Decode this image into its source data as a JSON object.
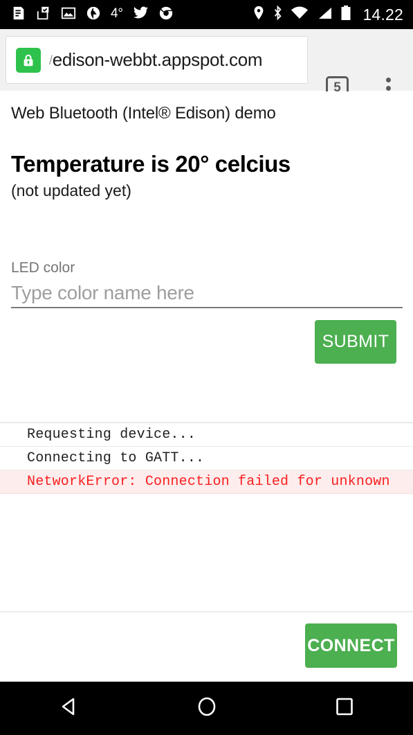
{
  "status_bar": {
    "icons": [
      {
        "name": "news-icon"
      },
      {
        "name": "inbox-check-icon"
      },
      {
        "name": "photo-icon"
      },
      {
        "name": "weather-app-icon"
      },
      {
        "name": "twitter-icon"
      },
      {
        "name": "chrome-icon"
      }
    ],
    "temperature": "4°",
    "right_icons": [
      {
        "name": "location-pin-icon"
      },
      {
        "name": "bluetooth-icon"
      },
      {
        "name": "wifi-icon"
      },
      {
        "name": "cell-signal-icon"
      },
      {
        "name": "battery-icon"
      }
    ],
    "clock": "14.22"
  },
  "browser": {
    "security_icon": "lock-icon",
    "url_clip": "/",
    "url": "edison-webbt.appspot.com",
    "tab_count": "5",
    "menu_icon": "overflow-menu-icon"
  },
  "page": {
    "title": "Web Bluetooth (Intel® Edison) demo",
    "temperature_heading": "Temperature is 20° celcius",
    "temperature_note": "(not updated yet)",
    "led_field": {
      "label": "LED color",
      "placeholder": "Type color name here",
      "value": ""
    },
    "submit_label": "SUBMIT",
    "connect_label": "CONNECT",
    "log": [
      {
        "text": "Requesting device...",
        "level": "info"
      },
      {
        "text": "Connecting to GATT...",
        "level": "info"
      },
      {
        "text": "NetworkError: Connection failed for unknown",
        "level": "error"
      }
    ]
  },
  "nav_bar": {
    "back": "back-icon",
    "home": "home-icon",
    "recents": "recents-icon"
  },
  "colors": {
    "accent_green": "#4caf50",
    "lock_green": "#2ec24c",
    "error_text": "#fa1f1f",
    "error_bg": "#fdeded"
  }
}
